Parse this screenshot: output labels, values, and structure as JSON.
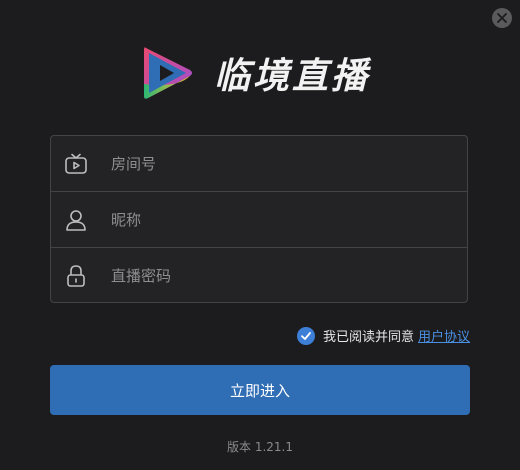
{
  "window": {
    "close_icon": "close-icon"
  },
  "logo": {
    "app_name": "临境直播"
  },
  "form": {
    "room_field": {
      "placeholder": "房间号",
      "value": "",
      "icon": "tv-icon"
    },
    "nickname_field": {
      "placeholder": "昵称",
      "value": "",
      "icon": "user-icon"
    },
    "password_field": {
      "placeholder": "直播密码",
      "value": "",
      "icon": "lock-icon"
    }
  },
  "agreement": {
    "checked": true,
    "text": "我已阅读并同意",
    "link_label": "用户协议"
  },
  "enter_button": {
    "label": "立即进入"
  },
  "footer": {
    "version": "版本 1.21.1"
  },
  "colors": {
    "background": "#1c1c1e",
    "accent": "#2f6db5",
    "link": "#4a90e2",
    "check": "#3d7fd6"
  }
}
